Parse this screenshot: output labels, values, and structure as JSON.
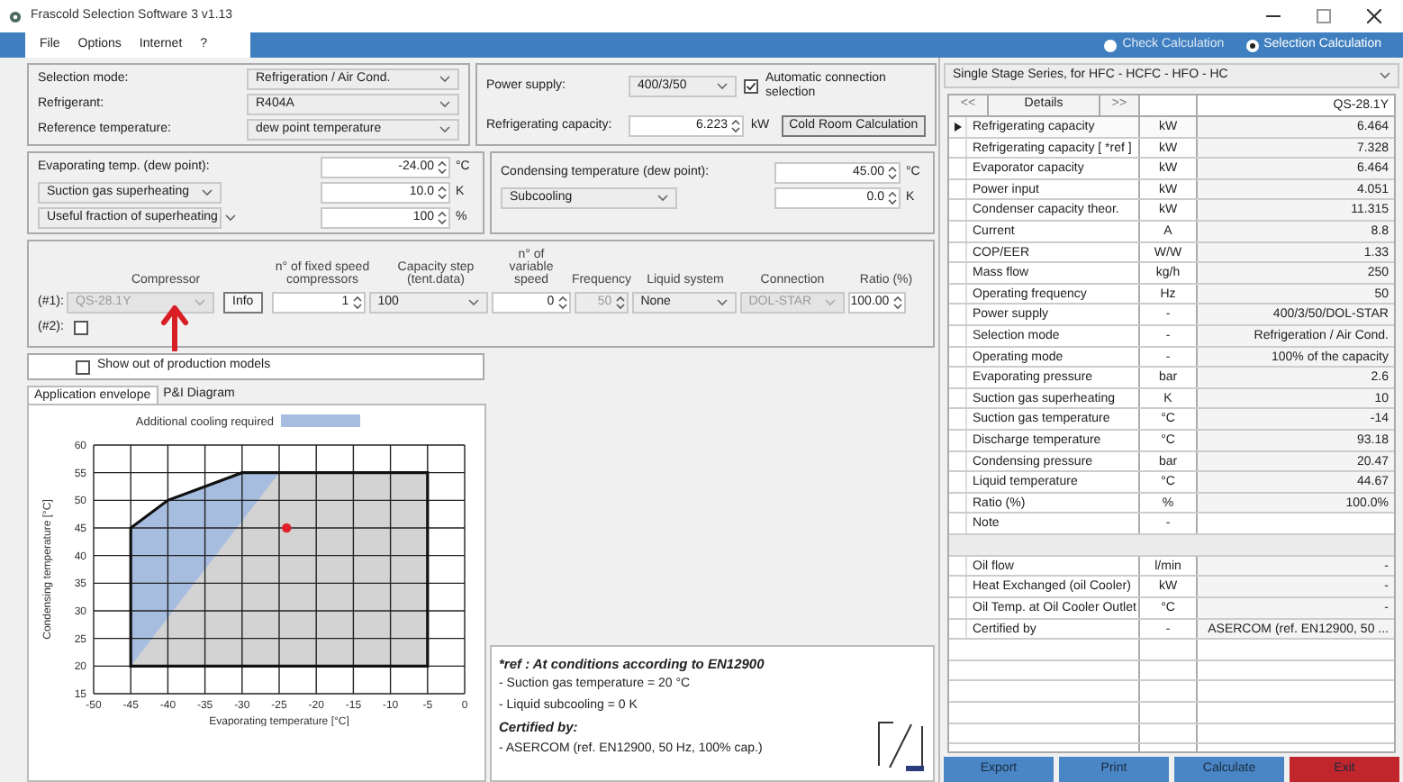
{
  "window": {
    "title": "Frascold Selection Software 3 v1.13"
  },
  "menu": [
    "File",
    "Options",
    "Internet",
    "?"
  ],
  "calculation_modes": [
    {
      "label": "Check Calculation",
      "selected": false
    },
    {
      "label": "Selection Calculation",
      "selected": true
    }
  ],
  "general": [
    {
      "label": "Selection mode:",
      "value": "Refrigeration / Air Cond."
    },
    {
      "label": "Refrigerant:",
      "value": "R404A"
    },
    {
      "label": "Reference temperature:",
      "value": "dew point temperature"
    }
  ],
  "power": {
    "label": "Power supply:",
    "value": "400/3/50",
    "auto_connection": {
      "label": "Automatic connection selection",
      "checked": true
    },
    "capacity_label": "Refrigerating capacity:",
    "capacity_value": "6.223",
    "capacity_unit": "kW",
    "cold_room_button": "Cold Room Calculation"
  },
  "evaporating": [
    {
      "kind": "label",
      "label": "Evaporating temp. (dew point):",
      "value": "-24.00",
      "unit": "°C"
    },
    {
      "kind": "select",
      "label": "Suction gas superheating",
      "value": "10.0",
      "unit": "K"
    },
    {
      "kind": "select",
      "label": "Useful fraction of superheating",
      "value": "100",
      "unit": "%"
    }
  ],
  "condensing": [
    {
      "kind": "label",
      "label": "Condensing temperature (dew point):",
      "value": "45.00",
      "unit": "°C"
    },
    {
      "kind": "select",
      "label": "Subcooling",
      "value": "0.0",
      "unit": "K"
    }
  ],
  "compressors": {
    "columns": [
      "Compressor",
      "n° of fixed speed compressors",
      "Capacity step (tent.data)",
      "n° of variable speed",
      "Frequency",
      "Liquid system",
      "Connection",
      "Ratio (%)"
    ],
    "first": {
      "label": "(#1):",
      "model": "QS-28.1Y",
      "model_disabled": true,
      "info_button": "Info",
      "fixed": "1",
      "step": "100",
      "variable": "0",
      "frequency": "50",
      "frequency_disabled": true,
      "liquid": "None",
      "connection": "DOL-STAR",
      "connection_disabled": true,
      "ratio": "100.00"
    },
    "second": {
      "label": "(#2):",
      "checked": false
    }
  },
  "show_out_of_production": {
    "label": "Show out of production models",
    "checked": false
  },
  "chart_tabs": [
    {
      "label": "Application envelope",
      "selected": true
    },
    {
      "label": "P&I Diagram",
      "selected": false
    }
  ],
  "chart_data": {
    "type": "area",
    "xlabel": "Evaporating temperature [°C]",
    "ylabel": "Condensing temperature [°C]",
    "xlim": [
      -50,
      0
    ],
    "ylim": [
      15,
      60
    ],
    "xticks": [
      -50,
      -45,
      -40,
      -35,
      -30,
      -25,
      -20,
      -15,
      -10,
      -5,
      0
    ],
    "yticks": [
      15,
      20,
      25,
      30,
      35,
      40,
      45,
      50,
      55,
      60
    ],
    "grid": true,
    "x": [
      -45,
      -45,
      -40,
      -30,
      -25,
      -5,
      -5
    ],
    "series": [
      {
        "color": "#d3d3d3",
        "values": [
          20,
          45,
          50,
          55,
          55,
          55,
          20
        ]
      },
      {
        "name": "Additional cooling required",
        "color": "#a7bde0",
        "values": [
          20,
          45,
          50,
          55,
          55,
          null,
          null
        ]
      }
    ]
  },
  "notes": {
    "title": "*ref : At conditions according to EN12900",
    "lines": [
      "- Suction gas temperature = 20 °C",
      "- Liquid subcooling = 0 K"
    ],
    "certified_title": "Certified by:",
    "certified_lines": [
      "- ASERCOM (ref. EN12900, 50 Hz, 100% cap.)"
    ]
  },
  "series_select": "Single Stage Series, for HFC - HCFC - HFO - HC",
  "results": {
    "prev": "<<",
    "details": "Details",
    "next": ">>",
    "model": "QS-28.1Y",
    "rows": [
      {
        "kind": "data",
        "name": "Refrigerating capacity",
        "unit": "kW",
        "value": "6.464",
        "selected": true
      },
      {
        "kind": "data",
        "name": "Refrigerating capacity [ *ref ]",
        "unit": "kW",
        "value": "7.328",
        "selected": false
      },
      {
        "kind": "data",
        "name": "Evaporator capacity",
        "unit": "kW",
        "value": "6.464",
        "selected": false
      },
      {
        "kind": "data",
        "name": "Power input",
        "unit": "kW",
        "value": "4.051",
        "selected": false
      },
      {
        "kind": "data",
        "name": "Condenser capacity theor.",
        "unit": "kW",
        "value": "11.315",
        "selected": false
      },
      {
        "kind": "data",
        "name": "Current",
        "unit": "A",
        "value": "8.8",
        "selected": false
      },
      {
        "kind": "data",
        "name": "COP/EER",
        "unit": "W/W",
        "value": "1.33",
        "selected": false
      },
      {
        "kind": "data",
        "name": "Mass flow",
        "unit": "kg/h",
        "value": "250",
        "selected": false
      },
      {
        "kind": "data",
        "name": "Operating frequency",
        "unit": "Hz",
        "value": "50",
        "selected": false
      },
      {
        "kind": "data",
        "name": "Power supply",
        "unit": "-",
        "value": "400/3/50/DOL-STAR",
        "selected": false
      },
      {
        "kind": "data",
        "name": "Selection mode",
        "unit": "-",
        "value": "Refrigeration / Air Cond.",
        "selected": false
      },
      {
        "kind": "data",
        "name": "Operating mode",
        "unit": "-",
        "value": "100% of the capacity",
        "selected": false
      },
      {
        "kind": "data",
        "name": "Evaporating pressure",
        "unit": "bar",
        "value": "2.6",
        "selected": false
      },
      {
        "kind": "data",
        "name": "Suction gas superheating",
        "unit": "K",
        "value": "10",
        "selected": false
      },
      {
        "kind": "data",
        "name": "Suction gas temperature",
        "unit": "°C",
        "value": "-14",
        "selected": false
      },
      {
        "kind": "data",
        "name": "Discharge temperature",
        "unit": "°C",
        "value": "93.18",
        "selected": false
      },
      {
        "kind": "data",
        "name": "Condensing pressure",
        "unit": "bar",
        "value": "20.47",
        "selected": false
      },
      {
        "kind": "data",
        "name": "Liquid temperature",
        "unit": "°C",
        "value": "44.67",
        "selected": false
      },
      {
        "kind": "data",
        "name": "Ratio (%)",
        "unit": "%",
        "value": "100.0%",
        "selected": false
      },
      {
        "kind": "data",
        "name": "Note",
        "unit": "-",
        "selected": false
      },
      {
        "kind": "separator"
      },
      {
        "kind": "data",
        "name": "Oil flow",
        "unit": "l/min",
        "value": "-",
        "selected": false
      },
      {
        "kind": "data",
        "name": "Heat Exchanged (oil Cooler)",
        "unit": "kW",
        "value": "-",
        "selected": false
      },
      {
        "kind": "data",
        "name": "Oil Temp. at Oil Cooler Outlet",
        "unit": "°C",
        "value": "-",
        "selected": false
      },
      {
        "kind": "data",
        "name": "Certified by",
        "unit": "-",
        "value": "ASERCOM (ref. EN12900, 50 ...",
        "selected": false
      }
    ]
  },
  "buttons": [
    {
      "label": "Export",
      "kind": "normal"
    },
    {
      "label": "Print",
      "kind": "normal"
    },
    {
      "label": "Calculate",
      "kind": "normal"
    },
    {
      "label": "Exit",
      "kind": "danger"
    }
  ]
}
